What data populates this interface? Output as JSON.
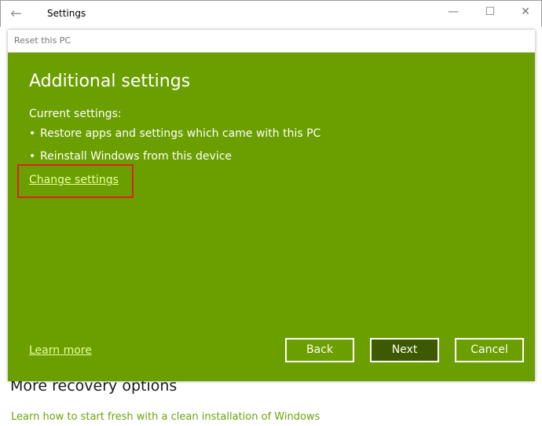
{
  "window": {
    "title": "Settings",
    "back_icon": "back-arrow-icon",
    "min_glyph": "—",
    "max_glyph": "☐",
    "close_glyph": "✕"
  },
  "background": {
    "heading": "More recovery options",
    "link": "Learn how to start fresh with a clean installation of Windows"
  },
  "dialog": {
    "title": "Reset this PC",
    "heading": "Additional settings",
    "current_label": "Current settings:",
    "bullets": [
      "Restore apps and settings which came with this PC",
      "Reinstall Windows from this device"
    ],
    "change_link": "Change settings",
    "learn_more": "Learn more",
    "buttons": {
      "back": "Back",
      "next": "Next",
      "cancel": "Cancel"
    }
  },
  "colors": {
    "accent": "#6b9f00",
    "next_button": "#3d5a00",
    "highlight": "#e02020"
  }
}
